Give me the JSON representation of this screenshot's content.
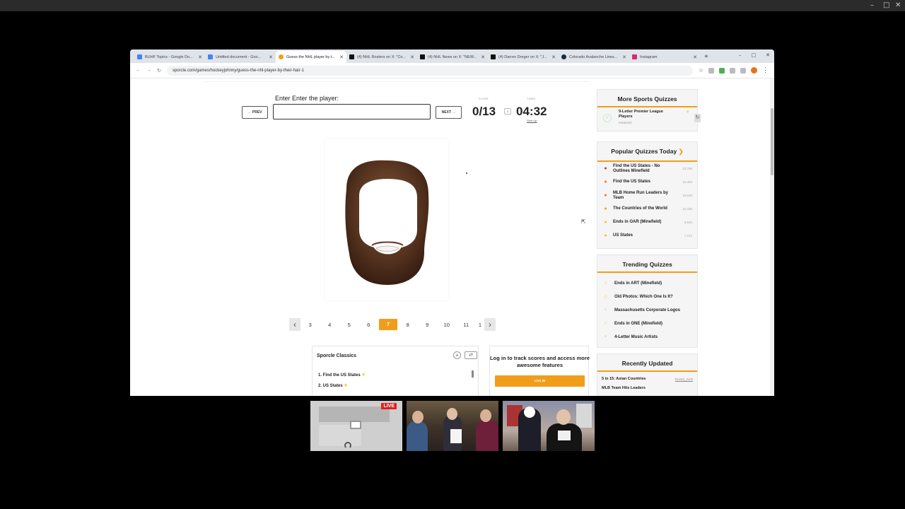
{
  "browser": {
    "tabs": [
      {
        "title": "BUHF Topics - Google Do...",
        "color": "#4285f4"
      },
      {
        "title": "Untitled document - Goo...",
        "color": "#4285f4"
      },
      {
        "title": "Guess the NHL player by t...",
        "color": "#f29d1a"
      },
      {
        "title": "(4) NHL Rosters on X: \"Co...",
        "color": "#111111"
      },
      {
        "title": "(4) NHL News on X: \"NEW...",
        "color": "#111111"
      },
      {
        "title": "(4) Darren Dreger on X: \"J...",
        "color": "#111111"
      },
      {
        "title": "Colorado Avalanche Lines...",
        "color": "#1e2a44"
      },
      {
        "title": "Instagram",
        "color": "#d62976"
      }
    ],
    "url": "sporcle.com/games/hockeyjohnny/guess-the-nhl-player-by-their-hair-1"
  },
  "quiz": {
    "prompt": "Enter Enter the player:",
    "prev_label": "← PREV",
    "next_label": "NEXT →",
    "answer_placeholder": "",
    "score_label": "SCORE",
    "score": "0/13",
    "pause_label": "II",
    "timer_label": "TIMER",
    "timer": "04:32",
    "give_up": "Give Up"
  },
  "pagination": {
    "pages": [
      "3",
      "4",
      "5",
      "6",
      "7",
      "8",
      "9",
      "10",
      "11",
      "1"
    ],
    "active": "7"
  },
  "classics": {
    "title": "Sporcle Classics",
    "items": [
      "1. Find the US States",
      "2. US States"
    ]
  },
  "login": {
    "text": "Log in to track scores and access more awesome features",
    "button": "LOG IN"
  },
  "more_sports": {
    "title": "More Sports Quizzes",
    "item": "9-Letter Premier League Players",
    "badge": "Featured"
  },
  "popular": {
    "title": "Popular Quizzes Today",
    "chevron": "❯",
    "items": [
      {
        "name": "Find the US States - No Outlines Minefield",
        "count": "23,768",
        "color": "#c0392b"
      },
      {
        "name": "Find the US States",
        "count": "16,393",
        "color": "#e8711c"
      },
      {
        "name": "MLB Home Run Leaders by Team",
        "count": "10,618",
        "color": "#e8711c"
      },
      {
        "name": "The Countries of the World",
        "count": "10,336",
        "color": "#f29d1a"
      },
      {
        "name": "Ends in OAR (Minefield)",
        "count": "8,545",
        "color": "#f5c518"
      },
      {
        "name": "US States",
        "count": "7,212",
        "color": "#f5c518"
      }
    ]
  },
  "trending": {
    "title": "Trending Quizzes",
    "items": [
      "Ends in ART (Minefield)",
      "Old Photos: Which One Is It?",
      "Massachusetts Corporate Logos",
      "Ends in ONE (Minefield)",
      "4-Letter Music Artists"
    ]
  },
  "recently": {
    "title": "Recently Updated",
    "item1": "5 in 15: Asian Countries",
    "author": "Doctor_Arch",
    "item2": "MLB Team Hits Leaders"
  },
  "stream": {
    "live": "LIVE"
  }
}
